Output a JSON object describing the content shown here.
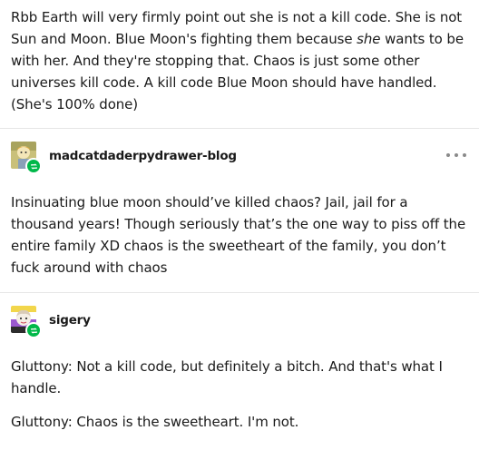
{
  "posts": [
    {
      "text_parts": [
        "Rbb Earth will very firmly point out she is not a kill code. She is not Sun and Moon. Blue Moon's fighting them because ",
        "she",
        " wants to be with her. And they're stopping that. Chaos is just some other universes kill code. A kill code Blue Moon should have handled. (She's 100% done)"
      ]
    },
    {
      "username": "madcatdaderpydrawer-blog",
      "text": "Insinuating blue moon should’ve killed chaos? Jail, jail for a thousand years! Though seriously that’s the one way to piss off the entire family XD chaos is the sweetheart of the family, you don’t fuck around with chaos"
    },
    {
      "username": "sigery",
      "paragraphs": [
        "Gluttony: Not a kill code, but definitely a bitch. And that's what I handle.",
        "Gluttony: Chaos is the sweetheart. I'm not."
      ]
    }
  ],
  "icons": {
    "more": "more-options-icon",
    "reblog": "reblog-icon"
  },
  "colors": {
    "text": "#1a1a1a",
    "reblog_badge": "#00b849",
    "separator": "#e6e6e6"
  }
}
